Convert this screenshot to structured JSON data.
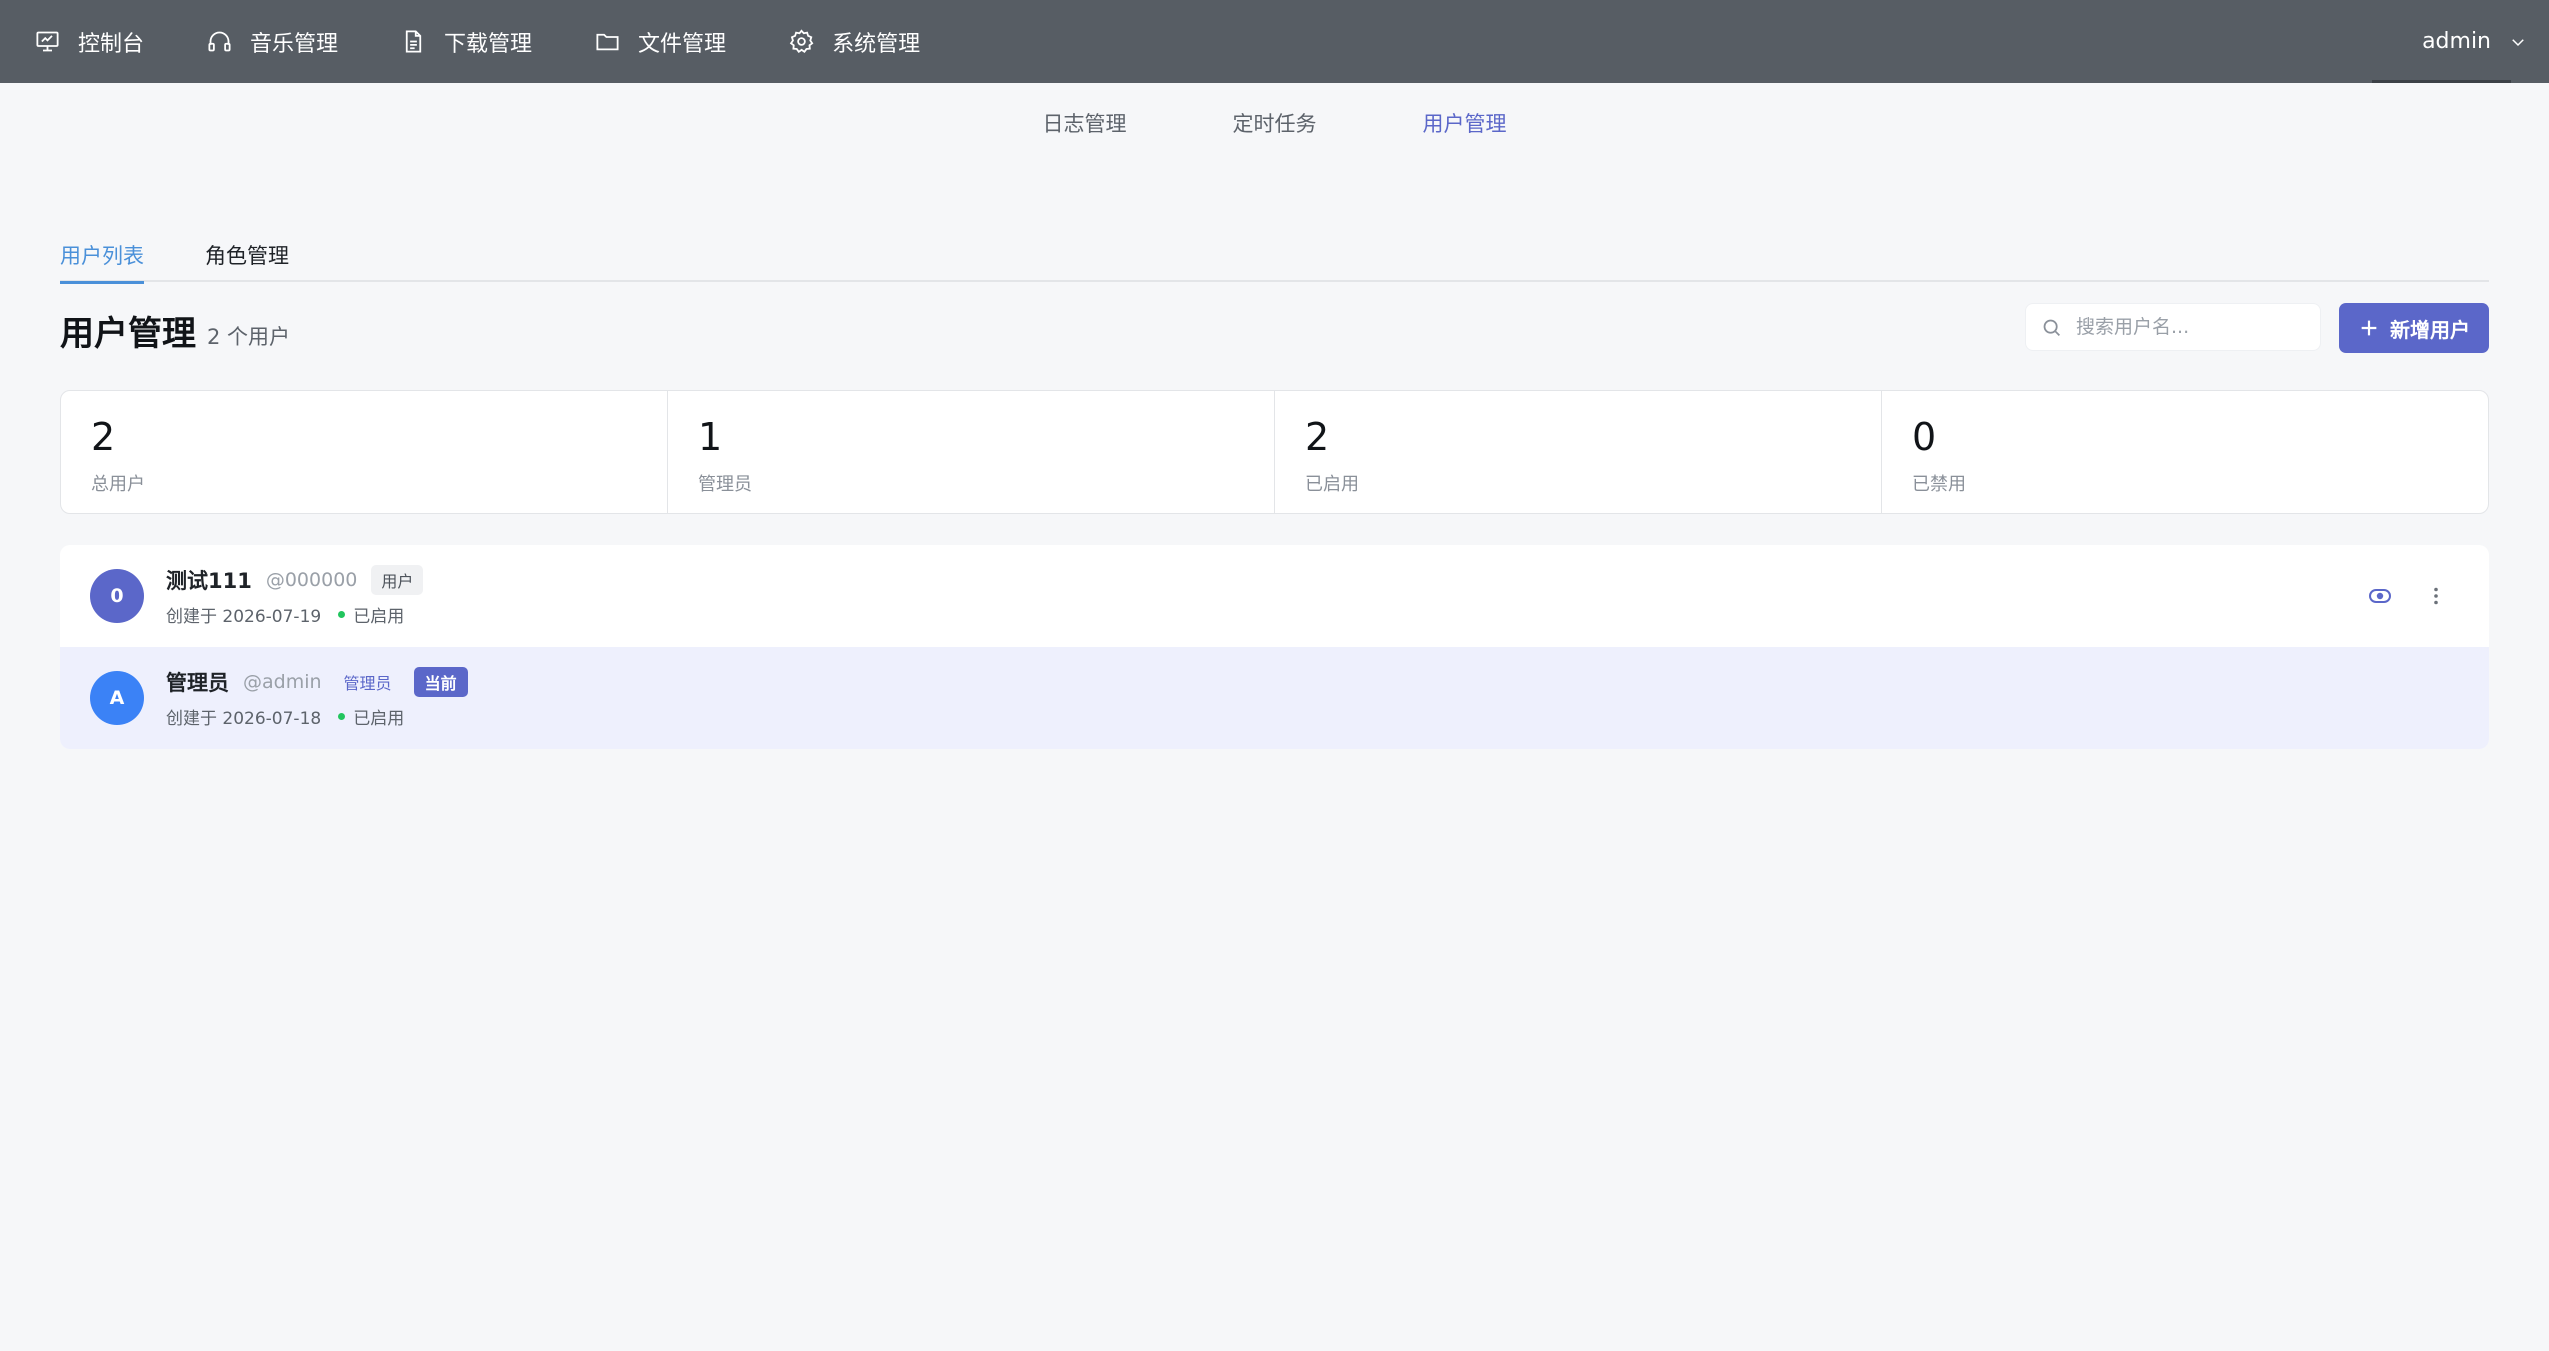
{
  "nav": {
    "items": [
      {
        "label": "控制台",
        "icon": "presentation-icon"
      },
      {
        "label": "音乐管理",
        "icon": "headphones-icon"
      },
      {
        "label": "下载管理",
        "icon": "document-icon"
      },
      {
        "label": "文件管理",
        "icon": "folder-icon"
      },
      {
        "label": "系统管理",
        "icon": "gear-icon"
      }
    ],
    "user": "admin"
  },
  "subnav": {
    "items": [
      "日志管理",
      "定时任务",
      "用户管理"
    ],
    "active": "用户管理"
  },
  "tabs": {
    "items": [
      "用户列表",
      "角色管理"
    ],
    "active": "用户列表"
  },
  "header": {
    "title": "用户管理",
    "count": "2 个用户",
    "search_placeholder": "搜索用户名...",
    "add_label": "新增用户"
  },
  "stats": [
    {
      "value": "2",
      "label": "总用户"
    },
    {
      "value": "1",
      "label": "管理员"
    },
    {
      "value": "2",
      "label": "已启用"
    },
    {
      "value": "0",
      "label": "已禁用"
    }
  ],
  "users": [
    {
      "initial": "0",
      "avatar_color": "#5b67c9",
      "name": "测试111",
      "login": "@000000",
      "role": "用户",
      "created": "创建于 2026-07-19",
      "status": "已启用"
    },
    {
      "initial": "A",
      "avatar_color": "#3b82f6",
      "name": "管理员",
      "login": "@admin",
      "role": "管理员",
      "current": "当前",
      "created": "创建于 2026-07-18",
      "status": "已启用"
    }
  ],
  "colors": {
    "topbar": "#575d64",
    "accent": "#5b67c9",
    "tab_active": "#4a90d9",
    "status_green": "#22c55e"
  }
}
